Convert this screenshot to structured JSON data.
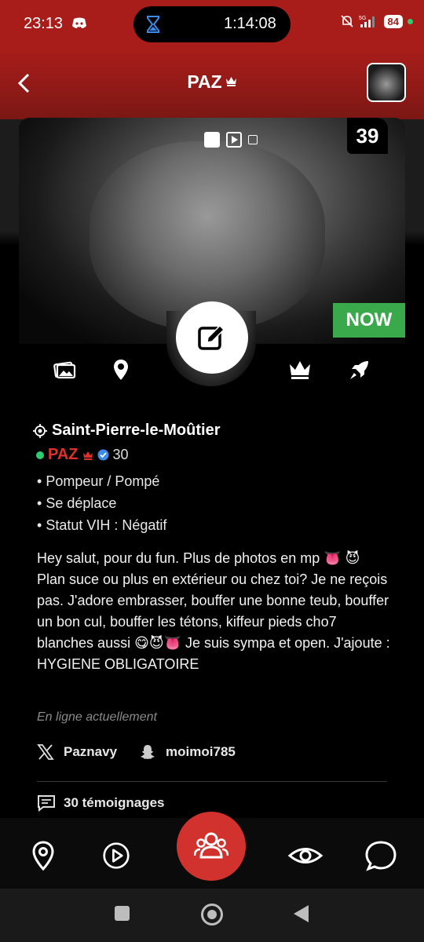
{
  "status_bar": {
    "time": "23:13",
    "timer": "1:14:08",
    "network": "5G",
    "battery": "84"
  },
  "header": {
    "title": "PAZ"
  },
  "photo": {
    "photo_count": "39",
    "now_badge": "NOW"
  },
  "profile": {
    "location": "Saint-Pierre-le-Moûtier",
    "username": "PAZ",
    "age": "30",
    "attributes": [
      "Pompeur / Pompé",
      "Se déplace",
      "Statut VIH : Négatif"
    ],
    "bio": "Hey salut, pour du fun. Plus de photos en mp 👅 😈 Plan suce ou plus en extérieur ou chez toi? Je ne reçois pas. J'adore embrasser, bouffer une bonne teub, bouffer un bon cul, bouffer les tétons, kiffeur pieds cho7 blanches aussi 😋😈👅 Je suis sympa et open. J'ajoute : HYGIENE OBLIGATOIRE",
    "online_status": "En ligne actuellement",
    "x_handle": "Paznavy",
    "snapchat_handle": "moimoi785",
    "testimonials": "30 témoignages"
  },
  "colors": {
    "brand_red": "#a81d1a",
    "accent_red": "#d2322d",
    "online_green": "#2ecc71",
    "now_green": "#3aa94b",
    "verified_blue": "#3b8beb"
  },
  "icons": {
    "actions": [
      "gallery-icon",
      "location-pin-icon",
      "edit-icon",
      "crown-icon",
      "rocket-icon"
    ],
    "bottom_nav": [
      "map-pin-icon",
      "play-icon",
      "users-icon",
      "eye-icon",
      "chat-icon"
    ]
  }
}
